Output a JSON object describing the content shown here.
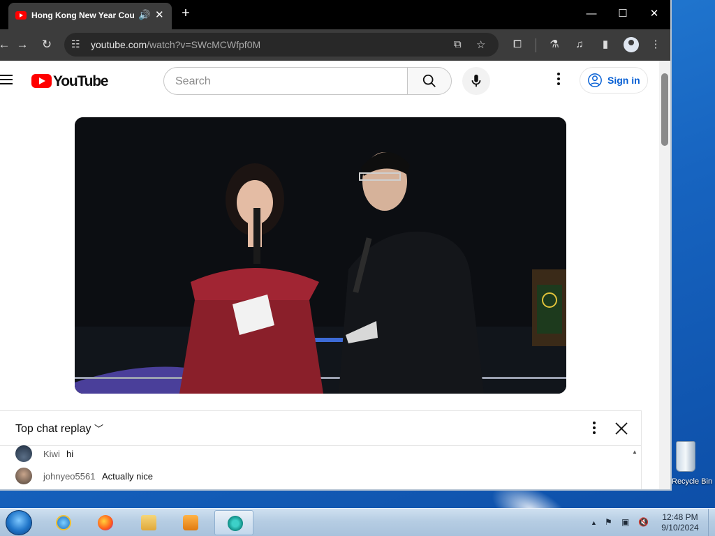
{
  "browser": {
    "tab_title": "Hong Kong New Year Cou",
    "new_tab": "+",
    "url_main": "youtube.com",
    "url_path": "/watch?v=SWcMCWfpf0M"
  },
  "youtube": {
    "logo_text": "YouTube",
    "search_placeholder": "Search",
    "sign_in": "Sign in"
  },
  "chat": {
    "header": "Top chat replay",
    "messages": [
      {
        "author": "Kiwi",
        "text": "hi"
      },
      {
        "author": "johnyeo5561",
        "text": "Actually nice"
      }
    ]
  },
  "desktop": {
    "recycle_bin_label": "Recycle Bin"
  },
  "taskbar": {
    "time": "12:48 PM",
    "date": "9/10/2024"
  },
  "icons": [
    "youtube-favicon",
    "speaker-icon",
    "close-icon",
    "back-icon",
    "forward-icon",
    "reload-icon",
    "tune-icon",
    "install-icon",
    "star-icon",
    "extensions-icon",
    "labs-icon",
    "media-icon",
    "sidepanel-icon",
    "profile-icon",
    "more-icon",
    "menu-icon",
    "search-icon",
    "mic-icon",
    "account-icon",
    "chevron-down-icon",
    "scroll-up-icon",
    "scroll-down-icon",
    "flag-icon",
    "network-icon",
    "volume-muted-icon"
  ],
  "colors": {
    "youtube_red": "#ff0000",
    "sign_in_blue": "#065fd4",
    "chrome_dark": "#3c3c3c"
  }
}
